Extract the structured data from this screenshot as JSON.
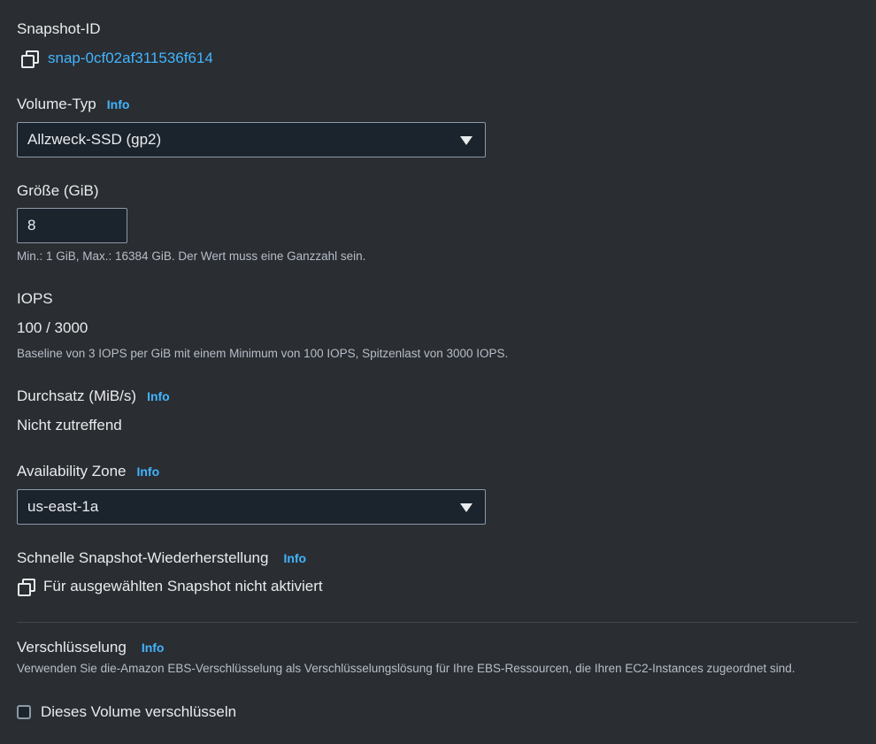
{
  "snapshot": {
    "label": "Snapshot-ID",
    "id": "snap-0cf02af311536f614",
    "icon": "copy-icon"
  },
  "volume_type": {
    "label": "Volume-Typ",
    "info": "Info",
    "selected": "Allzweck-SSD (gp2)"
  },
  "size": {
    "label": "Größe (GiB)",
    "value": "8",
    "hint": "Min.: 1 GiB, Max.: 16384 GiB. Der Wert muss eine Ganzzahl sein."
  },
  "iops": {
    "label": "IOPS",
    "value": "100 / 3000",
    "hint": "Baseline von 3 IOPS per GiB mit einem Minimum von 100 IOPS, Spitzenlast von 3000 IOPS."
  },
  "throughput": {
    "label": "Durchsatz (MiB/s)",
    "info": "Info",
    "value": "Nicht zutreffend"
  },
  "availability_zone": {
    "label": "Availability Zone",
    "info": "Info",
    "selected": "us-east-1a"
  },
  "fast_snapshot_restore": {
    "label": "Schnelle Snapshot-Wiederherstellung",
    "info": "Info",
    "status": "Für ausgewählten Snapshot nicht aktiviert",
    "icon": "copy-icon"
  },
  "encryption": {
    "label": "Verschlüsselung",
    "info": "Info",
    "description": "Verwenden Sie die-Amazon EBS-Verschlüsselung als Verschlüsselungslösung für Ihre EBS-Ressourcen, die Ihren EC2-Instances zugeordnet sind.",
    "checkbox_label": "Dieses Volume verschlüsseln",
    "checked": false
  },
  "colors": {
    "background": "#2a2d31",
    "link": "#42b4ff",
    "input_bg": "#1b232d",
    "border": "#8d99a8"
  }
}
